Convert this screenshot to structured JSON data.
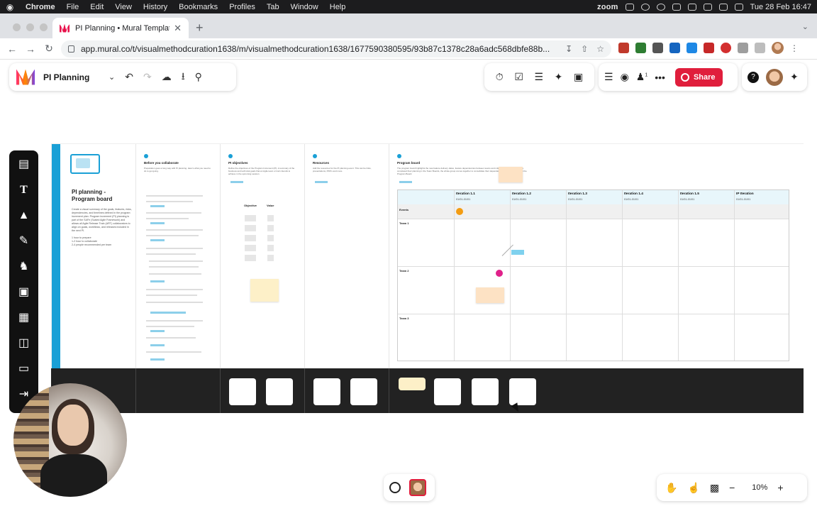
{
  "menubar": {
    "app": "Chrome",
    "items": [
      "File",
      "Edit",
      "View",
      "History",
      "Bookmarks",
      "Profiles",
      "Tab",
      "Window",
      "Help"
    ],
    "zoom_label": "zoom",
    "clock": "Tue 28 Feb  16:47"
  },
  "browser": {
    "tab_title": "PI Planning • Mural Templates",
    "url": "app.mural.co/t/visualmethodcuration1638/m/visualmethodcuration1638/1677590380595/93b87c1378c28a6adc568dbfe88b..."
  },
  "mural": {
    "board_name": "PI Planning",
    "share_label": "Share",
    "notification_count": "1",
    "zoom_level": "10%"
  },
  "board": {
    "template_title": "PI planning - Program board",
    "template_desc": "Create a visual summary of the goals, features, risks, dependencies, and timelines defined in the program increment plan. Program increment (PI) planning is part of the SAFe (Scaled Agile Framework) and allows all Agile Release Train (ART) collaborators to align on goals, workflows, and releases included in the next PI.",
    "meta": [
      "1 hour to prepare",
      "1-2 hour to collaborate",
      "2-4 people recommended per team"
    ],
    "sections": [
      {
        "title": "Before you collaborate",
        "sub": "Preparation goes a long way with PI planning. Here's what you need to do to get going."
      },
      {
        "title": "PI objectives",
        "sub": "Define the objectives of the Program Increment (PI). A summary of the business and technical goals that an Agile team or train intends to achieve in the upcoming session."
      },
      {
        "title": "Resources",
        "sub": "Add the resources for the PI planning event. This can be links, presentations, PDF's and more."
      },
      {
        "title": "Program board",
        "sub": "The program board highlights the new feature delivery dates, feature dependencies between teams and milestones. Once teams have completed their planning in the Team Boards, the whole group comes together to consolidate their dependencies and delivery dates in the Program Board."
      }
    ],
    "objectives_cols": [
      "Objective",
      "Value"
    ],
    "grid": {
      "columns": [
        {
          "name": "Iteration 1.1",
          "dates": "01/01-01/01"
        },
        {
          "name": "Iteration 1.2",
          "dates": "01/01-01/01"
        },
        {
          "name": "Iteration 1.3",
          "dates": "01/01-01/01"
        },
        {
          "name": "Iteration 1.4",
          "dates": "01/01-01/01"
        },
        {
          "name": "Iteration 1.5",
          "dates": "01/01-01/01"
        },
        {
          "name": "IP Iteration",
          "dates": "01/01-01/01"
        }
      ],
      "rows": [
        "Events",
        "Team 1",
        "Team 2",
        "Team 3"
      ]
    }
  },
  "icons": {
    "sidebar": [
      "sticky-note-icon",
      "text-icon",
      "shapes-icon",
      "pen-icon",
      "llama-icon",
      "image-icon",
      "templates-icon",
      "table-icon",
      "frame-icon",
      "import-icon"
    ],
    "toolbar_left": [
      "undo-icon",
      "redo-icon",
      "cloud-save-icon",
      "download-icon",
      "search-icon"
    ],
    "toolbar_right1": [
      "timer-icon",
      "checklist-icon",
      "private-mode-icon",
      "laser-pointer-icon",
      "toolbox-icon"
    ],
    "toolbar_right2": [
      "outline-icon",
      "comments-icon",
      "add-member-icon",
      "more-icon"
    ]
  },
  "colors": {
    "accent": "#e01e3c",
    "template_blue": "#1aa0d6",
    "grid_header": "#e8f6fb"
  }
}
